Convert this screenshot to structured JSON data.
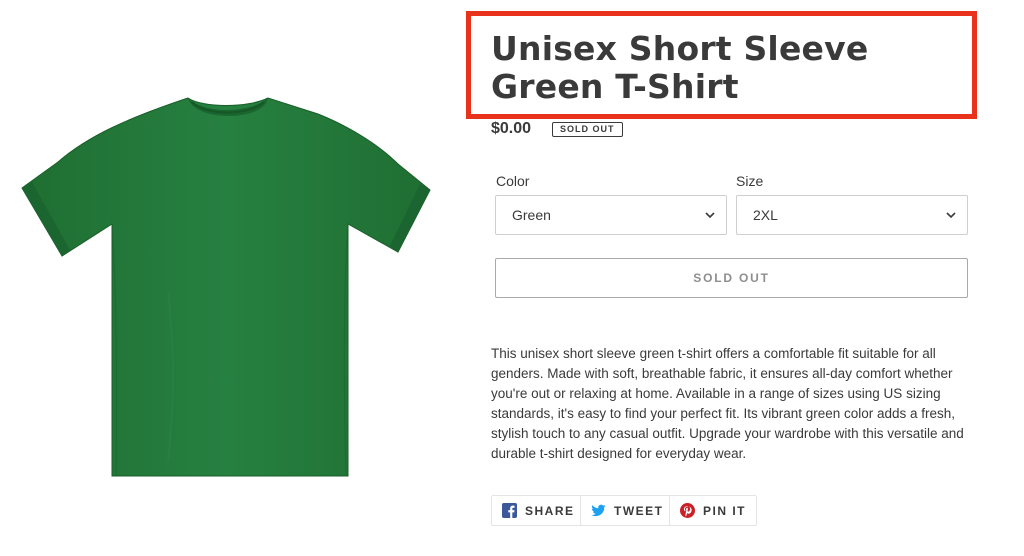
{
  "product": {
    "title": "Unisex Short Sleeve Green T-Shirt",
    "price": "$0.00",
    "badge": "SOLD OUT",
    "image_alt": "Green t-shirt",
    "image_color": "#237a38"
  },
  "options": {
    "color_label": "Color",
    "color_value": "Green",
    "size_label": "Size",
    "size_value": "2XL"
  },
  "cart": {
    "button_label": "SOLD OUT"
  },
  "description": "This unisex short sleeve green t-shirt offers a comfortable fit suitable for all genders. Made with soft, breathable fabric, it ensures all-day comfort whether you're out or relaxing at home. Available in a range of sizes using US sizing standards, it's easy to find your perfect fit. Its vibrant green color adds a fresh, stylish touch to any casual outfit. Upgrade your wardrobe with this versatile and durable t-shirt designed for everyday wear.",
  "share": {
    "facebook": "SHARE",
    "twitter": "TWEET",
    "pinterest": "PIN IT"
  },
  "colors": {
    "highlight": "#e8321c",
    "facebook": "#3b5998",
    "twitter": "#1da1f2",
    "pinterest": "#cb2027"
  }
}
